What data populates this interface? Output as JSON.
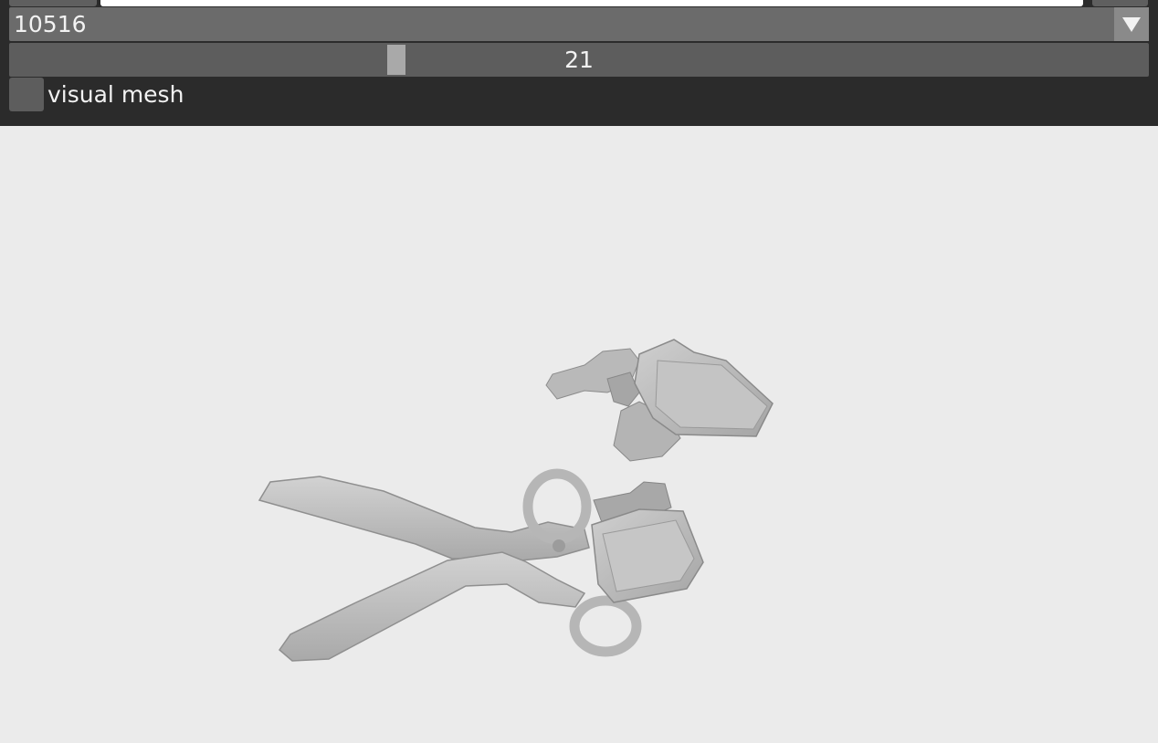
{
  "dropdown": {
    "selected": "10516"
  },
  "slider": {
    "value_label": "21",
    "fraction": 0.337
  },
  "checkbox": {
    "label": "visual mesh",
    "checked": false
  },
  "colors": {
    "panel_bg": "#2b2b2b",
    "viewport_bg": "#ebebeb",
    "control_bg": "#5d5d5d",
    "text": "#f2f2f2"
  },
  "icons": {
    "dropdown_arrow": "triangle-down-icon"
  }
}
